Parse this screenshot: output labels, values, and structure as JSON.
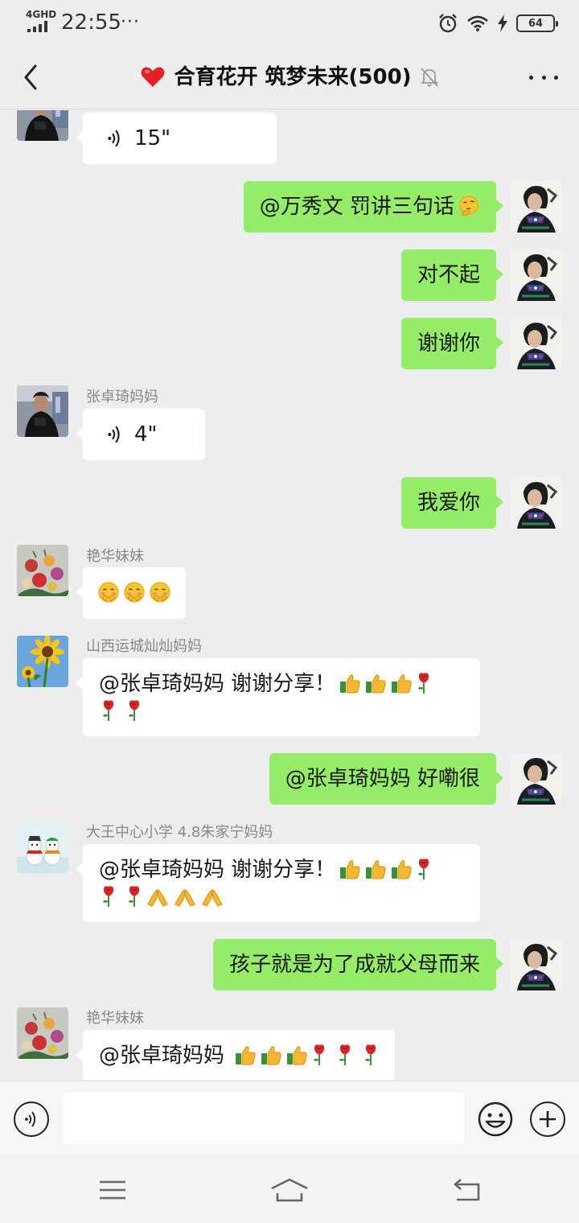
{
  "status_bar": {
    "network": "4GHD",
    "time": "22:55",
    "dots": "···",
    "battery": "64"
  },
  "header": {
    "title": "合育花开 筑梦未来(500)"
  },
  "messages": [
    {
      "side": "in",
      "type": "voice",
      "duration": "15\""
    },
    {
      "side": "out",
      "type": "text",
      "text": "@万秀文  罚讲三句话"
    },
    {
      "side": "out",
      "type": "text",
      "text": "对不起"
    },
    {
      "side": "out",
      "type": "text",
      "text": "谢谢你"
    },
    {
      "side": "in",
      "type": "voice",
      "sender": "张卓琦妈妈",
      "duration": "4\""
    },
    {
      "side": "out",
      "type": "text",
      "text": "我爱你"
    },
    {
      "side": "in",
      "type": "emoji",
      "sender": "艳华妹妹"
    },
    {
      "side": "in",
      "type": "text",
      "sender": "山西运城灿灿妈妈",
      "text": "@张卓琦妈妈  谢谢分享！"
    },
    {
      "side": "out",
      "type": "text",
      "text": "@张卓琦妈妈  好嘞很"
    },
    {
      "side": "in",
      "type": "text",
      "sender": "大王中心小学 4.8朱家宁妈妈",
      "text": "@张卓琦妈妈  谢谢分享！"
    },
    {
      "side": "out",
      "type": "text",
      "text": "孩子就是为了成就父母而来"
    },
    {
      "side": "in",
      "type": "text",
      "sender": "艳华妹妹",
      "text": "@张卓琦妈妈"
    }
  ],
  "input": {
    "value": "",
    "placeholder": ""
  },
  "icons": {
    "back": "chevron-left-icon",
    "mute": "bell-off-icon",
    "more": "more-dots-icon",
    "voice": "voice-icon",
    "emoji": "emoji-icon",
    "plus": "plus-icon",
    "nav": [
      "menu-icon",
      "home-icon",
      "back-icon"
    ]
  },
  "colors": {
    "out_bubble": "#95ec69",
    "in_bubble": "#ffffff",
    "background": "#ededed"
  }
}
